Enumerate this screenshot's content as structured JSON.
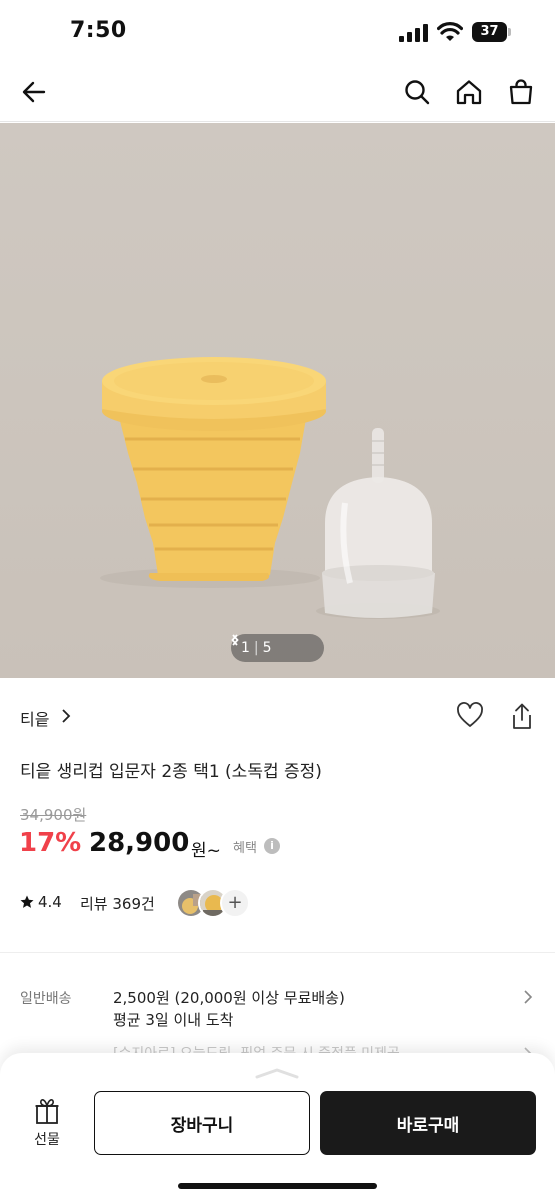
{
  "status_bar": {
    "time": "7:50",
    "battery_level": "37"
  },
  "navbar": {
    "back_icon": "arrow-left-icon",
    "search_icon": "search-icon",
    "home_icon": "home-icon",
    "bag_icon": "shopping-bag-icon"
  },
  "gallery": {
    "current": "1",
    "separator": "|",
    "total": "5"
  },
  "product": {
    "brand": "티읕",
    "title": "티읕 생리컵 입문자 2종 택1 (소독컵 증정)",
    "original_price": "34,900원",
    "discount": "17%",
    "price": "28,900",
    "price_unit": "원~",
    "benefit_label": "혜택",
    "info_icon": "i",
    "rating": "4.4",
    "review_label": "리뷰 369건",
    "more_reviews": "+"
  },
  "shipping": {
    "label": "일반배송",
    "line1": "2,500원 (20,000원 이상 무료배송)",
    "line2": "평균 3일 이내 도착",
    "peek": "[수지아로] 오늘드림, 픽업 주문 시 증정품 미제공"
  },
  "bottom_bar": {
    "gift_label": "선물",
    "cart_label": "장바구니",
    "buy_label": "바로구매"
  },
  "colors": {
    "discount": "#f0414a",
    "buy_button": "#1a1a1a",
    "product_cup": "#f5cc6a"
  }
}
